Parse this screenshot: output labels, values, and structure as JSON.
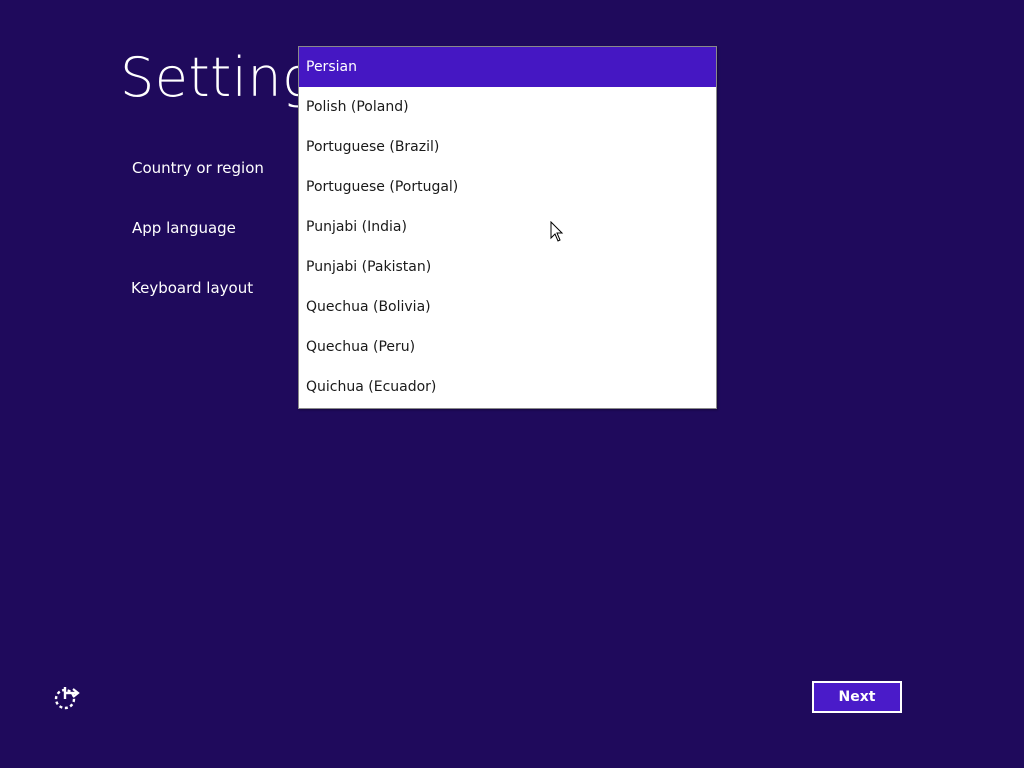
{
  "page": {
    "title": "Settings",
    "background_color": "#1f0a5c",
    "accent_color": "#4517c3"
  },
  "fields": {
    "country_label": "Country or region",
    "app_language_label": "App language",
    "keyboard_layout_label": "Keyboard layout"
  },
  "dropdown": {
    "selected": "Persian",
    "items": [
      "Persian",
      "Polish (Poland)",
      "Portuguese (Brazil)",
      "Portuguese (Portugal)",
      "Punjabi (India)",
      "Punjabi (Pakistan)",
      "Quechua (Bolivia)",
      "Quechua (Peru)",
      "Quichua (Ecuador)"
    ]
  },
  "footer": {
    "ease_of_access_icon": "ease-of-access-icon",
    "next_label": "Next"
  }
}
